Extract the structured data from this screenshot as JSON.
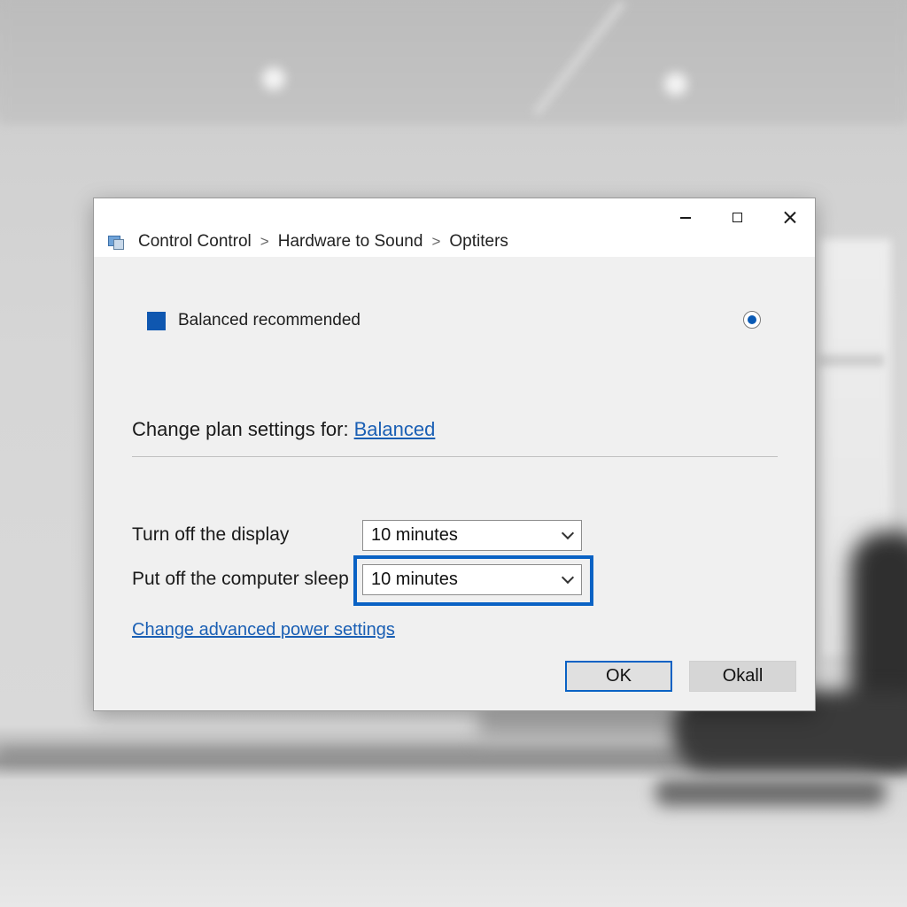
{
  "window": {
    "minimize_icon": "minimize-icon",
    "maximize_icon": "maximize-icon",
    "close_icon": "close-icon"
  },
  "breadcrumb": {
    "icon": "control-panel-icon",
    "items": [
      "Control Control",
      "Hardware to Sound",
      "Optiters"
    ],
    "separator": ">"
  },
  "plan": {
    "label": "Balanced recommended",
    "selected": true,
    "color": "#0f57b0"
  },
  "settings_header": {
    "prefix": "Change plan settings for:",
    "plan_link": "Balanced"
  },
  "settings": [
    {
      "label": "Turn off the display",
      "value": "10 minutes"
    },
    {
      "label": "Put off the computer sleep",
      "value": "10 minutes"
    }
  ],
  "advanced_link": "Change advanced power settings",
  "buttons": {
    "ok": "OK",
    "okall": "Okall"
  },
  "colors": {
    "accent": "#0a62c4",
    "link": "#1a5fb4"
  }
}
